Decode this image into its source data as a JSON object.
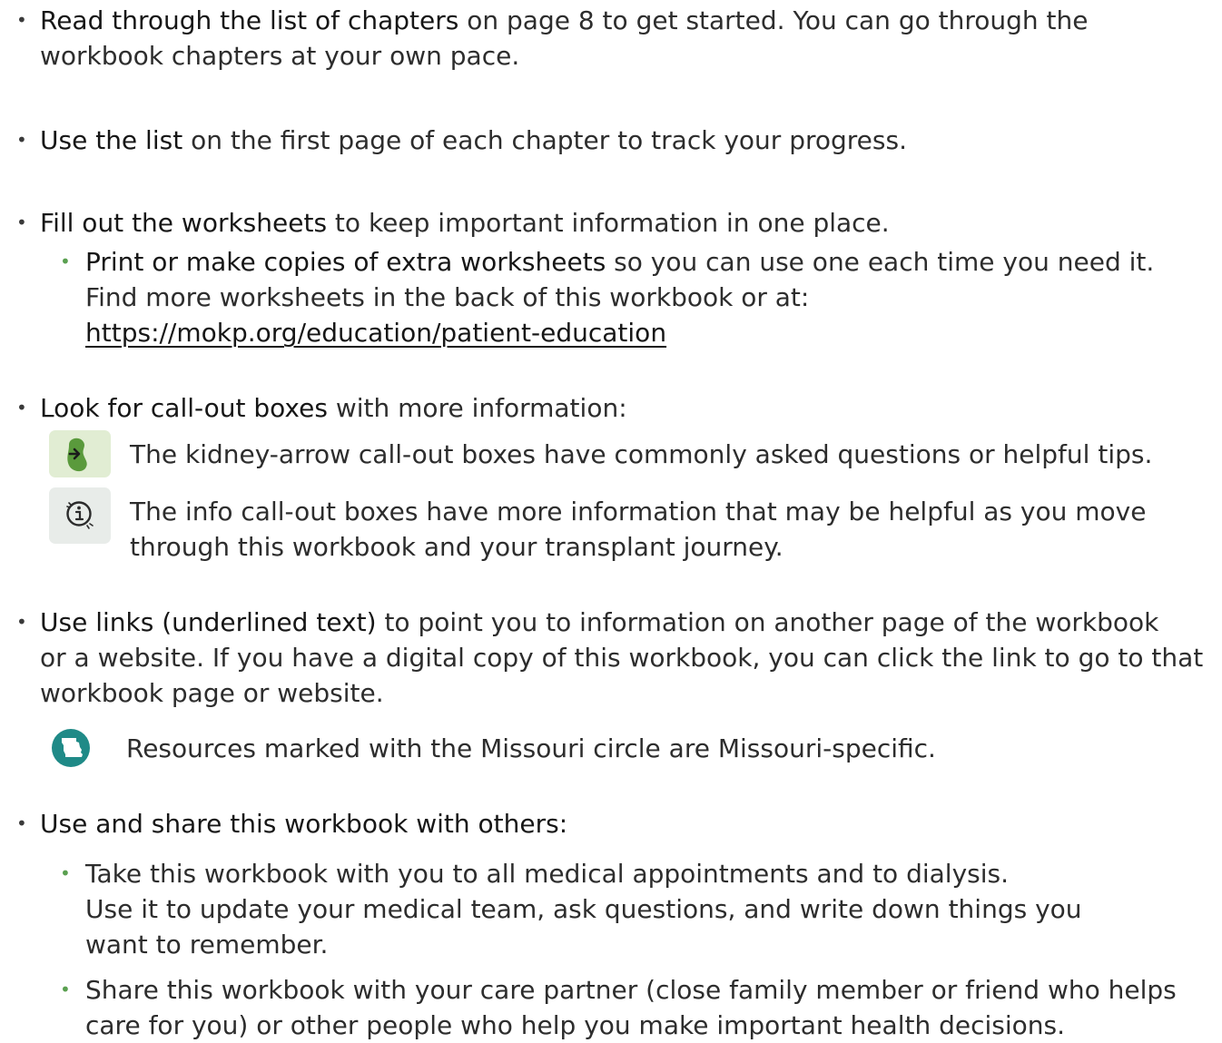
{
  "bullets": {
    "chapters": {
      "strong": "Read through the list of chapters",
      "rest_line1": " on page 8 to get started. You can go through the",
      "line2": "workbook chapters at your own pace."
    },
    "list": {
      "strong": "Use the list",
      "rest": " on the first page of each chapter to track your progress."
    },
    "worksheets": {
      "strong": "Fill out the worksheets",
      "rest": " to keep important information in one place.",
      "sub": {
        "strong": "Print or make copies of extra worksheets",
        "rest": " so you can use one each time you need it.",
        "line2": "Find more worksheets in the back of this workbook or at:",
        "link": "https://mokp.org/education/patient-education"
      }
    },
    "callouts": {
      "strong": "Look for call-out boxes",
      "rest": " with more information:",
      "kidney_text": "The kidney-arrow call-out boxes have commonly asked questions or helpful tips.",
      "info_line1": "The info call-out boxes have more information that may be helpful as you move",
      "info_line2": "through this workbook and your transplant journey."
    },
    "links": {
      "strong": "Use links (underlined text)",
      "rest_line1": " to point you to information on another page of the workbook",
      "line2": "or a website. If you have a digital copy of this workbook, you can click the link to go to that",
      "line3": "workbook page or website.",
      "missouri_text": "Resources marked with the Missouri circle are Missouri-specific."
    },
    "share": {
      "strong": "Use and share this workbook with others:",
      "sub1_line1": "Take this workbook with you to all medical appointments and to dialysis.",
      "sub1_line2": "Use it to update your medical team, ask questions, and write down things you",
      "sub1_line3": "want to remember.",
      "sub2_line1": "Share this workbook with your care partner (close family member or friend who helps",
      "sub2_line2": "care for you) or other people who help you make important health decisions."
    }
  },
  "icons": {
    "kidney": "kidney-arrow-icon",
    "info": "info-icon",
    "missouri": "missouri-circle-icon"
  },
  "colors": {
    "kidney_green": "#5a9a3c",
    "teal": "#1f8a87",
    "bullet_green": "#5aa050"
  }
}
